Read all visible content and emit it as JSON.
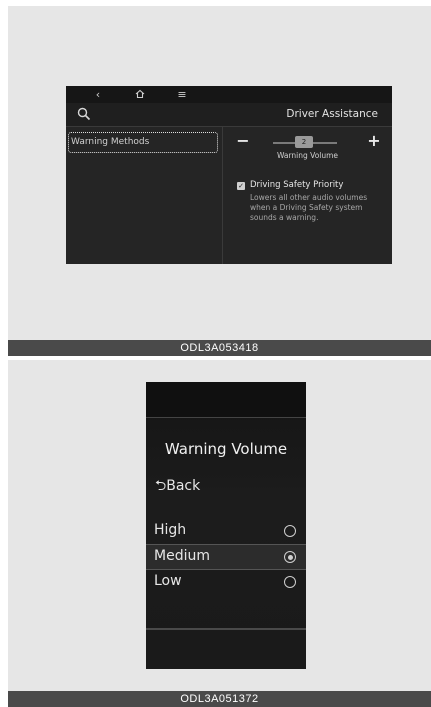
{
  "screen1": {
    "nav": {
      "back_icon": "back-icon",
      "home_icon": "home-icon",
      "menu_icon": "menu-icon"
    },
    "title": "Driver Assistance",
    "menu_items": [
      {
        "label": "Warning Methods",
        "focused": true
      }
    ],
    "volume": {
      "minus": "−",
      "plus": "+",
      "value": "2",
      "label": "Warning Volume"
    },
    "option": {
      "checked": true,
      "title": "Driving Safety Priority",
      "description": "Lowers all other audio volumes when a Driving Safety system sounds a warning."
    },
    "caption": "ODL3A053418"
  },
  "screen2": {
    "title": "Warning Volume",
    "back_label": "⮌Back",
    "options": [
      {
        "label": "High",
        "selected": false
      },
      {
        "label": "Medium",
        "selected": true
      },
      {
        "label": "Low",
        "selected": false
      }
    ],
    "caption": "ODL3A051372"
  }
}
